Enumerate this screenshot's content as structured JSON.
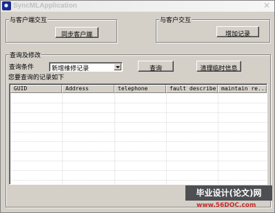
{
  "window": {
    "title": "SyncMLApplication",
    "close_glyph": "✕"
  },
  "client_group": {
    "legend": "与客户端交互",
    "sync_button": "同步客户端"
  },
  "customer_group": {
    "legend": "与客户交互",
    "add_button": "增加记录"
  },
  "query_group": {
    "legend": "查询及修改",
    "condition_label": "查询条件",
    "condition_value": "新增维修记录",
    "query_button": "查询",
    "clear_button": "清理临时信息",
    "result_label": "您要查询的记录如下"
  },
  "table": {
    "columns": [
      "GUID",
      "Address",
      "telephone",
      "fault describe",
      "maintain re..."
    ],
    "rows": []
  },
  "watermark": {
    "banner": "毕业设计(论文)网",
    "url": "www.56DOC.com"
  },
  "colors": {
    "face": "#d4d0c8",
    "shadow": "#808080",
    "watermark_bg": "#4d4f52",
    "watermark_url": "#cc2b2b"
  },
  "icons": [
    "app-icon",
    "close-icon",
    "dropdown-arrow-icon"
  ]
}
